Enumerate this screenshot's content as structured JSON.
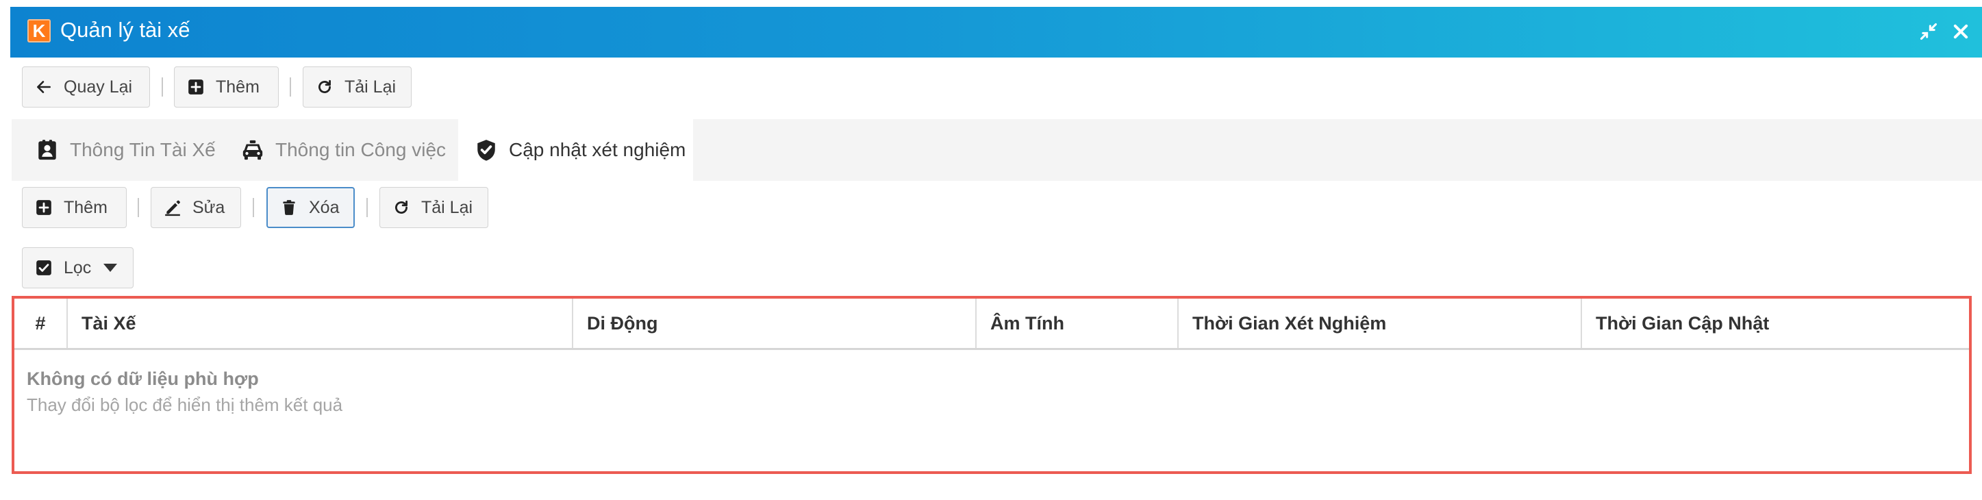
{
  "window": {
    "title": "Quản lý tài xế",
    "logo_letter": "K",
    "controls": [
      "compress-icon",
      "close-icon"
    ]
  },
  "toolbar_top": {
    "back_label": "Quay Lại",
    "add_label": "Thêm",
    "reload_label": "Tải Lại"
  },
  "tabs": [
    {
      "label": "Thông Tin Tài Xế",
      "icon": "driver-id-card-icon",
      "selected": false
    },
    {
      "label": "Thông tin Công việc",
      "icon": "taxi-icon",
      "selected": false
    },
    {
      "label": "Cập nhật xét nghiệm",
      "icon": "shield-check-icon",
      "selected": true
    }
  ],
  "toolbar_sub": {
    "add_label": "Thêm",
    "edit_label": "Sửa",
    "delete_label": "Xóa",
    "reload_label": "Tải Lại"
  },
  "filter": {
    "label": "Lọc"
  },
  "table": {
    "columns": [
      "#",
      "Tài Xế",
      "Di Động",
      "Âm Tính",
      "Thời Gian Xét Nghiệm",
      "Thời Gian Cập Nhật"
    ],
    "rows": [],
    "empty_title": "Không có dữ liệu phù hợp",
    "empty_subtitle": "Thay đổi bộ lọc để hiển thị thêm kết quả"
  },
  "colors": {
    "titlebar_start": "#0d83d0",
    "titlebar_end": "#20c0dc",
    "logo": "#ff7a1a",
    "grid_highlight": "#ec5b52",
    "active_button_border": "#4a8cc9"
  }
}
